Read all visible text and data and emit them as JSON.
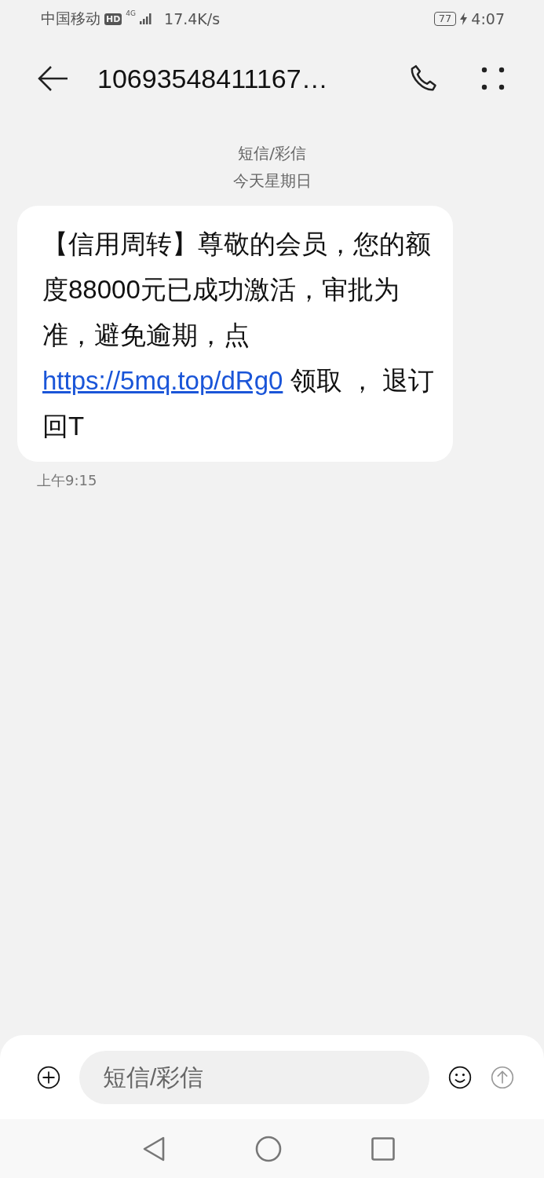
{
  "status_bar": {
    "carrier": "中国移动",
    "hd": "HD",
    "network": "4G",
    "speed": "17.4K/s",
    "battery": "77",
    "charging": true,
    "time": "4:07"
  },
  "header": {
    "title": "10693548411167…"
  },
  "thread": {
    "type_label": "短信/彩信",
    "date_label": "今天星期日",
    "messages": [
      {
        "text_before": "【信用周转】尊敬的会员，您的额度88000元已成功激活，审批为准，避免逾期，点 ",
        "link": "https://5mq.top/dRg0",
        "text_after": " 领取 ， 退订回T",
        "time": "上午9:15"
      }
    ]
  },
  "composer": {
    "placeholder": "短信/彩信"
  }
}
